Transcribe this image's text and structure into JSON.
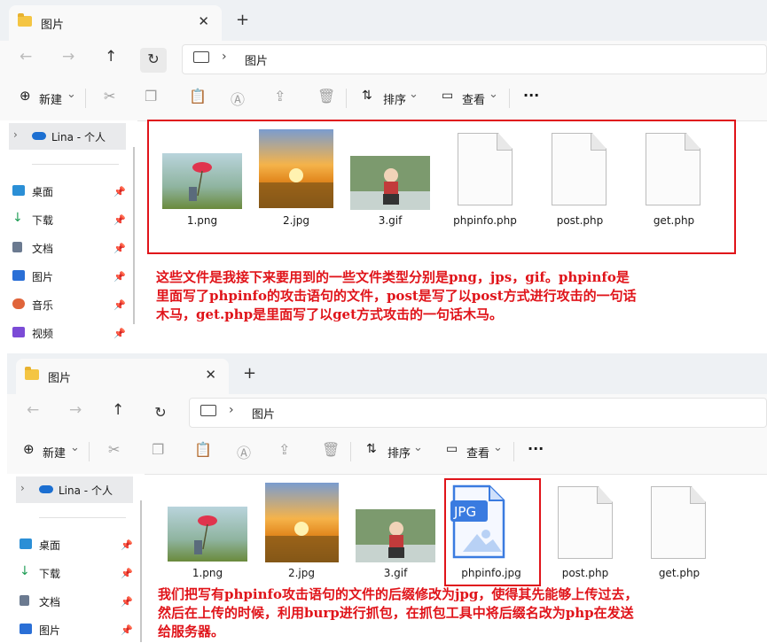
{
  "window": {
    "tab_title": "图片",
    "tab_close": "✕",
    "new_tab": "+",
    "breadcrumb": "图片",
    "breadcrumb_sep": "›"
  },
  "nav": {
    "back": "←",
    "forward": "→",
    "up": "↑",
    "refresh": "↻"
  },
  "toolbar": {
    "new_label": "新建",
    "sort_label": "排序",
    "view_label": "查看",
    "more": "···",
    "dropdown": "⌄"
  },
  "sidebar": {
    "account": "Lina - 个人",
    "items": [
      {
        "label": "桌面",
        "color": "#2b8fd6"
      },
      {
        "label": "下载",
        "color": "#1f9d55"
      },
      {
        "label": "文档",
        "color": "#6b7a90"
      },
      {
        "label": "图片",
        "color": "#2a6fd6"
      },
      {
        "label": "音乐",
        "color": "#e0643a"
      },
      {
        "label": "视频",
        "color": "#7b4bd6"
      }
    ]
  },
  "top_files": [
    "1.png",
    "2.jpg",
    "3.gif",
    "phpinfo.php",
    "post.php",
    "get.php"
  ],
  "bottom_files": [
    "1.png",
    "2.jpg",
    "3.gif",
    "phpinfo.jpg",
    "post.php",
    "get.php"
  ],
  "jpg_badge": "JPG",
  "annotation_top": [
    "这些文件是我接下来要用到的一些文件类型分别是png，jps，gif。phpinfo是",
    "里面写了phpinfo的攻击语句的文件，post是写了以post方式进行攻击的一句话",
    "木马，get.php是里面写了以get方式攻击的一句话木马。"
  ],
  "annotation_bottom": [
    "我们把写有phpinfo攻击语句的文件的后缀修改为jpg，使得其先能够上传过去，",
    "然后在上传的时候，利用burp进行抓包，在抓包工具中将后缀名改为php在发送",
    "给服务器。"
  ],
  "colors": {
    "annotation": "#e0141a",
    "accent": "#1c6fd1"
  }
}
